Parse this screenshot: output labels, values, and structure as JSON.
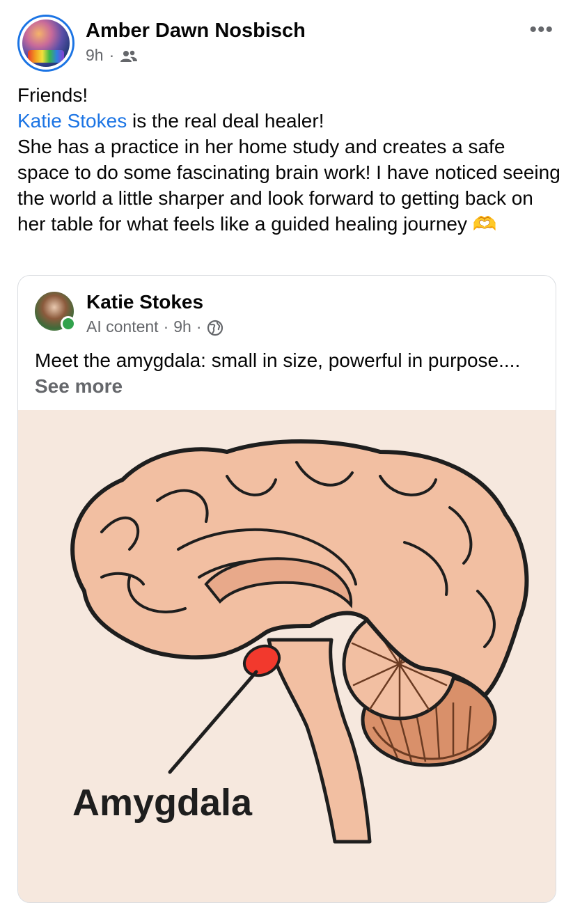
{
  "post": {
    "author": "Amber Dawn Nosbisch",
    "time": "9h",
    "separator": "·",
    "audience_icon": "friends-icon",
    "more_icon": "•••",
    "greeting": "Friends!",
    "mention": "Katie Stokes",
    "line1_rest": " is the real deal healer!",
    "body": "She has a practice in her home study and creates a safe space to do some fascinating brain work! I have noticed seeing the world a little sharper and look forward to getting back on her table for what feels like a guided healing journey",
    "emoji": "🫶"
  },
  "shared": {
    "author": "Katie Stokes",
    "label": "AI content",
    "separator": "·",
    "time": "9h",
    "audience_icon": "globe-icon",
    "text": "Meet the amygdala: small in size, powerful in purpose....",
    "see_more": "See more",
    "illustration": {
      "label": "Amygdala",
      "colors": {
        "background": "#f6e8de",
        "brain": "#f2bfa2",
        "cerebellum": "#d9906a",
        "amygdala": "#f2392d"
      }
    }
  }
}
